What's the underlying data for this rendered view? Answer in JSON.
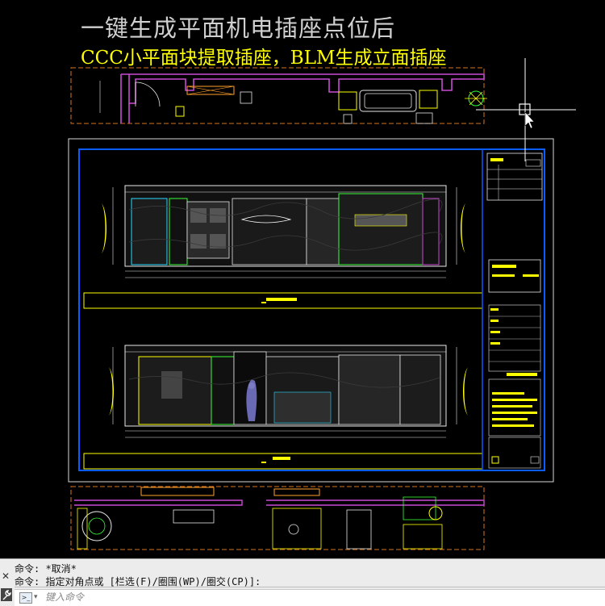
{
  "annotation": {
    "title": "一键生成平面机电插座点位后",
    "subtitle": "CCC小平面块提取插座，BLM生成立面插座"
  },
  "colors": {
    "background": "#000000",
    "title_text": "#cfcfcf",
    "subtitle_text": "#ffff00",
    "frame_blue": "#0a5cff",
    "frame_white": "#d9d9d9",
    "dash_orange": "#d9731f",
    "wall_magenta": "#c84bd1",
    "elevation_outline": "#e6e6e6",
    "accent_green": "#39ff39",
    "accent_cyan": "#27d9ff",
    "accent_yellow": "#ffff00",
    "command_bg": "#ececec"
  },
  "command_line": {
    "history": [
      "命令: *取消*",
      "命令: 指定对角点或 [栏选(F)/圈围(WP)/圈交(CP)]:"
    ],
    "input_placeholder": "键入命令",
    "close_icon": "close-icon",
    "settings_icon": "wrench-icon",
    "prompt_icon": "command-prompt-icon"
  },
  "cursor": {
    "type": "crosshair-pickbox-arrow"
  }
}
